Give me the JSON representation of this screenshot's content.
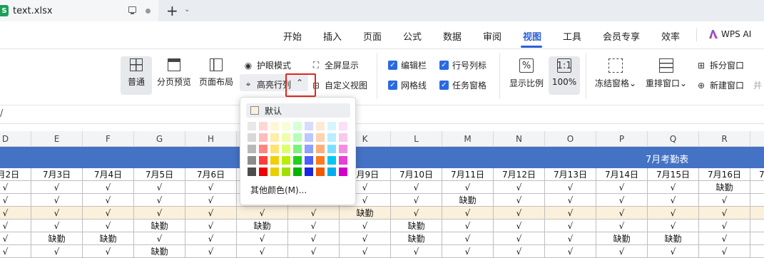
{
  "tab": {
    "icon_letter": "S",
    "title": "text.xlsx"
  },
  "menu": {
    "items": [
      "开始",
      "插入",
      "页面",
      "公式",
      "数据",
      "审阅",
      "视图",
      "工具",
      "会员专享",
      "效率"
    ],
    "active_index": 6,
    "wps_ai": "WPS AI"
  },
  "ribbon": {
    "normal": "普通",
    "page_break_preview": "分页预览",
    "page_layout": "页面布局",
    "eye_care": "护眼模式",
    "highlight_rowcol": "高亮行列",
    "fullscreen": "全屏显示",
    "custom_view": "自定义视图",
    "formula_bar": "编辑栏",
    "row_col_headers": "行号列标",
    "gridlines": "网格线",
    "task_pane": "任务窗格",
    "zoom_ratio": "显示比例",
    "zoom_100": "100%",
    "freeze_panes": "冻结窗格",
    "rearrange_windows": "重排窗口",
    "split_window": "拆分窗口",
    "new_window": "新建窗口",
    "side_by_side_cut": "并"
  },
  "formula_bar": {
    "content": "/"
  },
  "columns": [
    "D",
    "E",
    "F",
    "G",
    "H",
    "I",
    "J",
    "K",
    "L",
    "M",
    "N",
    "O",
    "P",
    "Q",
    "R",
    "S"
  ],
  "sheet": {
    "title": "7月考勤表",
    "dates": [
      "7月2日",
      "7月3日",
      "7月4日",
      "7月5日",
      "7月6日",
      "7月7日",
      "7月8日",
      "7月9日",
      "7月10日",
      "7月11日",
      "7月12日",
      "7月13日",
      "7月14日",
      "7月15日",
      "7月16日",
      "7月17日"
    ],
    "rows": [
      [
        "√",
        "√",
        "√",
        "√",
        "√",
        "√",
        "√",
        "√",
        "√",
        "√",
        "√",
        "√",
        "√",
        "√",
        "缺勤",
        "√"
      ],
      [
        "√",
        "√",
        "√",
        "√",
        "√",
        "√",
        "√",
        "√",
        "√",
        "缺勤",
        "√",
        "√",
        "√",
        "√",
        "√",
        "√"
      ],
      [
        "√",
        "√",
        "√",
        "√",
        "√",
        "√",
        "√",
        "缺勤",
        "√",
        "√",
        "√",
        "√",
        "√",
        "√",
        "√",
        "√"
      ],
      [
        "√",
        "√",
        "√",
        "缺勤",
        "√",
        "缺勤",
        "√",
        "√",
        "缺勤",
        "√",
        "√",
        "√",
        "√",
        "√",
        "√",
        "√"
      ],
      [
        "√",
        "缺勤",
        "缺勤",
        "√",
        "√",
        "√",
        "√",
        "√",
        "缺勤",
        "√",
        "√",
        "√",
        "缺勤",
        "缺勤",
        "√",
        "√"
      ],
      [
        "√",
        "√",
        "√",
        "缺勤",
        "√",
        "√",
        "√",
        "√",
        "√",
        "√",
        "√",
        "√",
        "√",
        "√",
        "√",
        "√"
      ]
    ],
    "highlighted_row": 2
  },
  "color_popup": {
    "default_label": "默认",
    "more_colors": "其他颜色(M)...",
    "swatch_colors": [
      [
        "#e8e8e8",
        "#ffd6d6",
        "#fff6d6",
        "#f6ffd6",
        "#d6ffd6",
        "#d6dcff",
        "#ffe8d6",
        "#d6f6ff",
        "#fbe0f6"
      ],
      [
        "#d8d8d8",
        "#ffbcbc",
        "#ffeda8",
        "#eeffa8",
        "#b6ffb6",
        "#bcc6ff",
        "#ffd2b0",
        "#b6efff",
        "#f8c8ee"
      ],
      [
        "#b8b8b8",
        "#ff8484",
        "#ffe270",
        "#dcff70",
        "#7cf27c",
        "#8fa0ff",
        "#ffb07a",
        "#7cdfff",
        "#f28fe0"
      ],
      [
        "#8c8c8c",
        "#ff3c3c",
        "#f0d000",
        "#b8ef00",
        "#20d020",
        "#4b5dff",
        "#ff7a1e",
        "#00c8f0",
        "#e840d0"
      ],
      [
        "#4c4c4c",
        "#f00000",
        "#e6d000",
        "#a0e000",
        "#00b400",
        "#1a26e6",
        "#f05a00",
        "#00aef0",
        "#d400c8"
      ]
    ]
  }
}
